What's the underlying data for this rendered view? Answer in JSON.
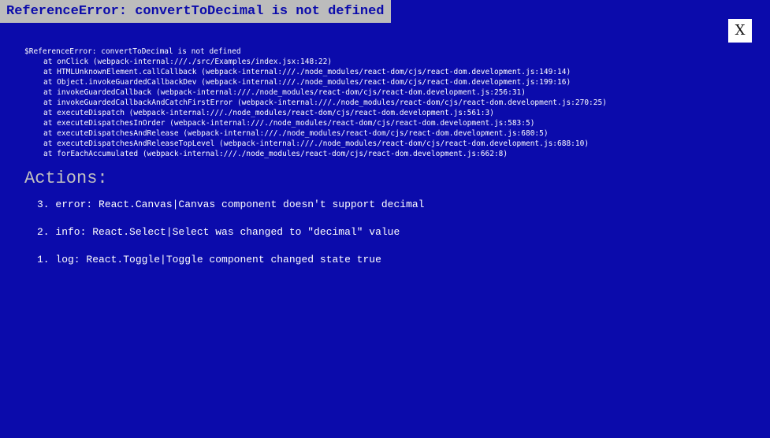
{
  "error_title": "ReferenceError: convertToDecimal is not defined",
  "close_label": "X",
  "stack": {
    "message": "$ReferenceError: convertToDecimal is not defined",
    "frames": [
      "at onClick (webpack-internal:///./src/Examples/index.jsx:148:22)",
      "at HTMLUnknownElement.callCallback (webpack-internal:///./node_modules/react-dom/cjs/react-dom.development.js:149:14)",
      "at Object.invokeGuardedCallbackDev (webpack-internal:///./node_modules/react-dom/cjs/react-dom.development.js:199:16)",
      "at invokeGuardedCallback (webpack-internal:///./node_modules/react-dom/cjs/react-dom.development.js:256:31)",
      "at invokeGuardedCallbackAndCatchFirstError (webpack-internal:///./node_modules/react-dom/cjs/react-dom.development.js:270:25)",
      "at executeDispatch (webpack-internal:///./node_modules/react-dom/cjs/react-dom.development.js:561:3)",
      "at executeDispatchesInOrder (webpack-internal:///./node_modules/react-dom/cjs/react-dom.development.js:583:5)",
      "at executeDispatchesAndRelease (webpack-internal:///./node_modules/react-dom/cjs/react-dom.development.js:680:5)",
      "at executeDispatchesAndReleaseTopLevel (webpack-internal:///./node_modules/react-dom/cjs/react-dom.development.js:688:10)",
      "at forEachAccumulated (webpack-internal:///./node_modules/react-dom/cjs/react-dom.development.js:662:8)"
    ]
  },
  "actions": {
    "heading": "Actions:",
    "items": [
      "3. error: React.Canvas|Canvas component doesn't support decimal",
      "2. info: React.Select|Select was changed to \"decimal\" value",
      "1. log: React.Toggle|Toggle component changed state true"
    ]
  },
  "colors": {
    "background": "#0b0bab",
    "title_bar": "#bcbcbc",
    "title_text": "#0b0bab",
    "heading_text": "#c0c0c0",
    "body_text": "#ffffff"
  }
}
